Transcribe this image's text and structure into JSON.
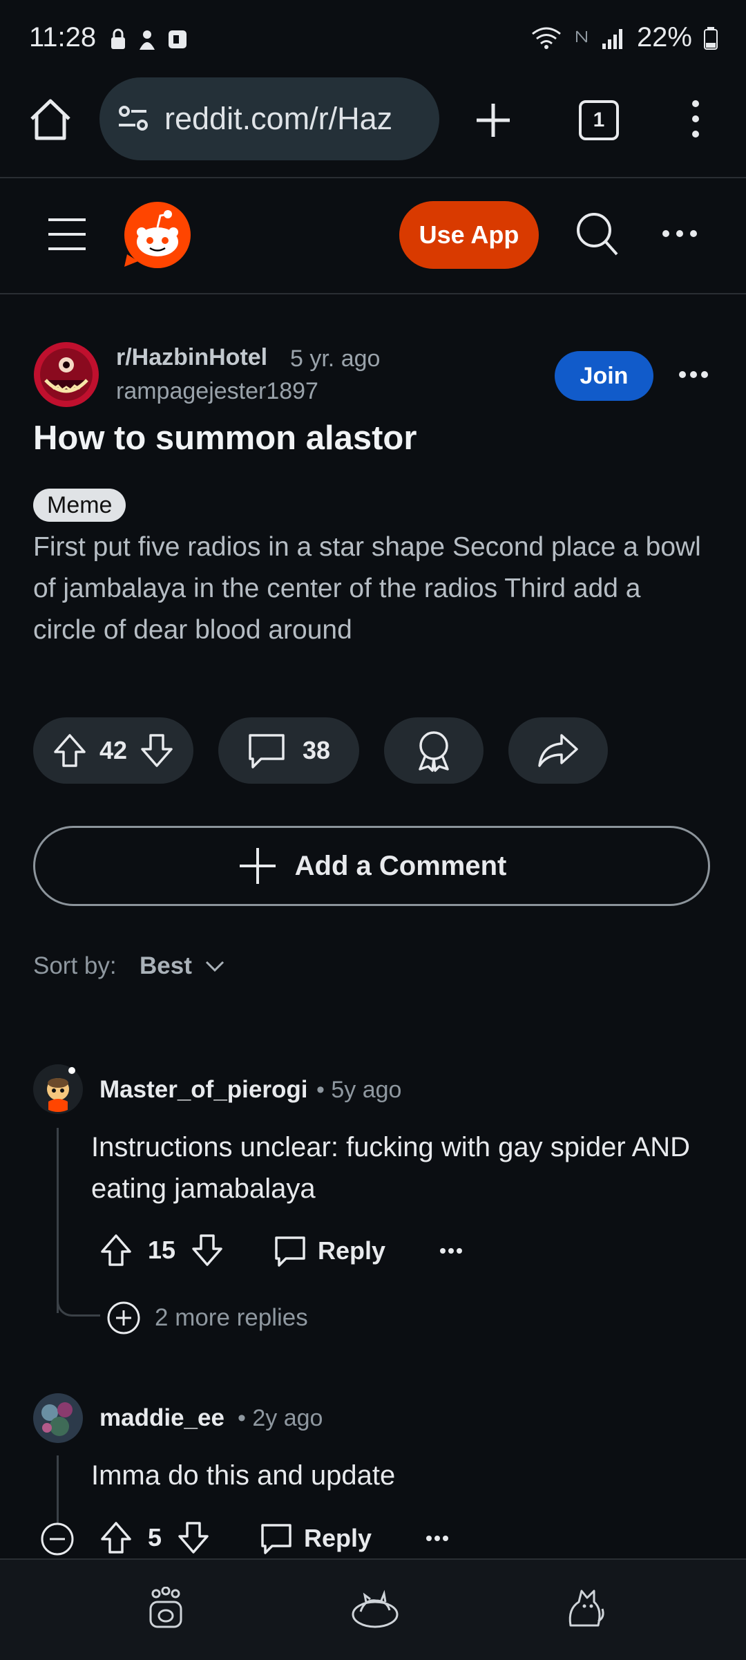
{
  "status": {
    "time": "11:28",
    "battery": "22%"
  },
  "browser": {
    "url": "reddit.com/r/Haz",
    "tab_count": "1"
  },
  "header": {
    "use_app": "Use App"
  },
  "post": {
    "subreddit": "r/HazbinHotel",
    "age": "5 yr. ago",
    "author": "rampagejester1897",
    "join": "Join",
    "title": "How to summon alastor",
    "flair": "Meme",
    "body": "First put five radios in a star shape Second place a bowl of jambalaya in the center of the radios Third add a circle of dear blood around",
    "votes": "42",
    "comments": "38"
  },
  "add_comment": "Add a Comment",
  "sort": {
    "label": "Sort by:",
    "value": "Best"
  },
  "comments": [
    {
      "user": "Master_of_pierogi",
      "time": "• 5y ago",
      "text": "Instructions unclear: fucking with gay spider AND eating jamabalaya",
      "votes": "15",
      "reply": "Reply",
      "more_replies": "2 more replies"
    },
    {
      "user": "maddie_ee",
      "time": "• 2y ago",
      "text": "Imma do this and update",
      "votes": "5",
      "reply": "Reply"
    }
  ],
  "colors": {
    "background": "#0b0e12",
    "use_app": "#d93a00",
    "join": "#115bca",
    "reddit_orange": "#ff4500"
  }
}
